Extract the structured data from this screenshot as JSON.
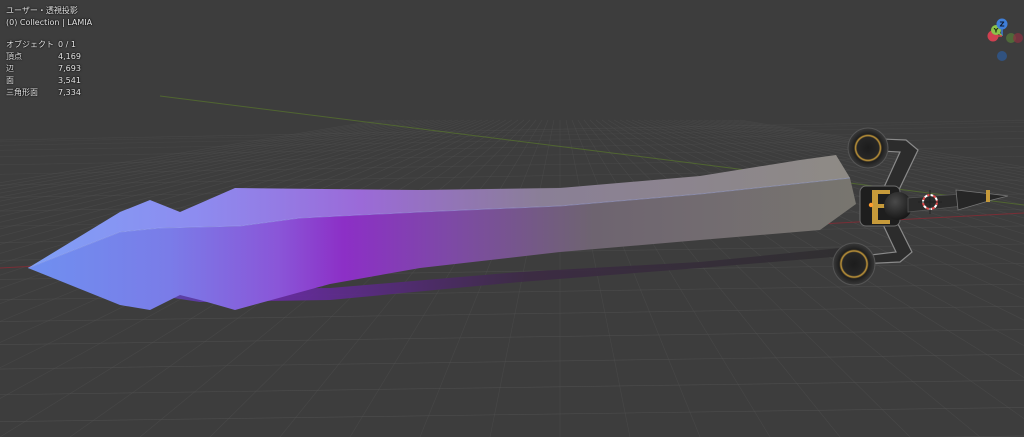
{
  "viewport": {
    "view_label": "ユーザー・透視投影",
    "collection_label": "(0) Collection | LAMIA",
    "stats": [
      {
        "label": "オブジェクト",
        "value": "0 / 1"
      },
      {
        "label": "頂点",
        "value": "4,169"
      },
      {
        "label": "辺",
        "value": "7,693"
      },
      {
        "label": "面",
        "value": "3,541"
      },
      {
        "label": "三角形面",
        "value": "7,334"
      }
    ]
  },
  "gizmo": {
    "z_label": "Z",
    "y_label": "Y",
    "colors": {
      "x": "#d04050",
      "y": "#8bc34a",
      "z": "#3f7fd9"
    }
  },
  "colors": {
    "background": "#3d3d3d",
    "grid": "#545454",
    "x_axis": "#7a2e36",
    "y_axis": "#55702e",
    "blade_tip": "#6f8ff2",
    "blade_mid": "#8a2fc4",
    "blade_base": "#7a7874",
    "hilt": "#2a2a2a",
    "gold": "#c79a3a"
  }
}
